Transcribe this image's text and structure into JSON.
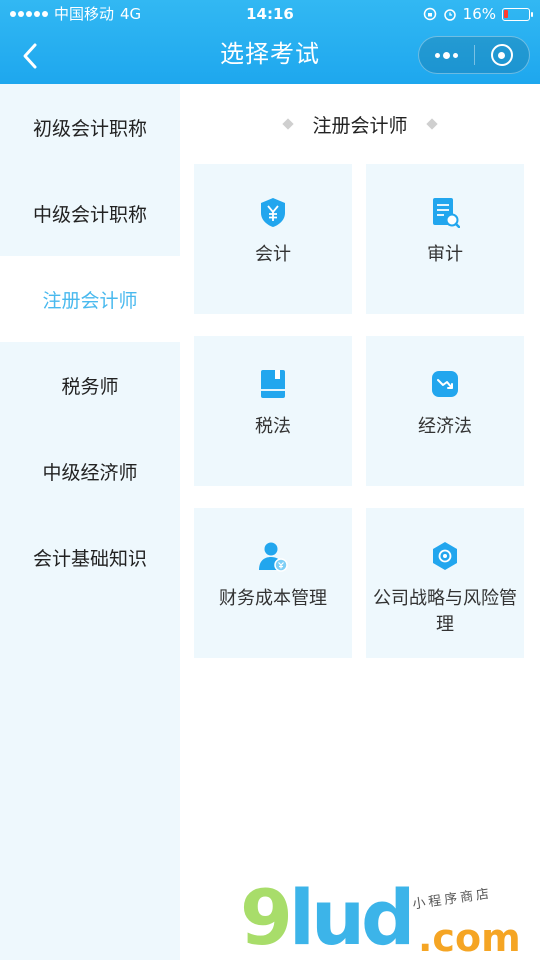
{
  "status_bar": {
    "carrier": "中国移动",
    "network": "4G",
    "time": "14:16",
    "battery": "16%",
    "battery_level": 0.16
  },
  "nav": {
    "back_icon": "chevron-left-icon",
    "title": "选择考试",
    "more_icon": "more-dots-icon",
    "close_icon": "target-circle-icon"
  },
  "sidebar": {
    "items": [
      {
        "label": "初级会计职称",
        "active": false
      },
      {
        "label": "中级会计职称",
        "active": false
      },
      {
        "label": "注册会计师",
        "active": true
      },
      {
        "label": "税务师",
        "active": false
      },
      {
        "label": "中级经济师",
        "active": false
      },
      {
        "label": "会计基础知识",
        "active": false
      }
    ]
  },
  "main": {
    "section_title": "注册会计师",
    "cards": [
      {
        "label": "会计",
        "icon": "yen-shield-icon"
      },
      {
        "label": "审计",
        "icon": "document-search-icon"
      },
      {
        "label": "税法",
        "icon": "book-icon"
      },
      {
        "label": "经济法",
        "icon": "trend-down-icon"
      },
      {
        "label": "财务成本管理",
        "icon": "person-money-icon"
      },
      {
        "label": "公司战略与风险管理",
        "icon": "gear-hexagon-icon"
      }
    ]
  },
  "watermark": {
    "brand": "9lud",
    "domain": ".com",
    "tagline": "小程序商店"
  },
  "colors": {
    "header": "#1ea7ee",
    "accent": "#49b9ee",
    "sidebar_bg": "#eef8fd",
    "card_bg": "#eef8fd",
    "icon": "#22a6ee"
  }
}
